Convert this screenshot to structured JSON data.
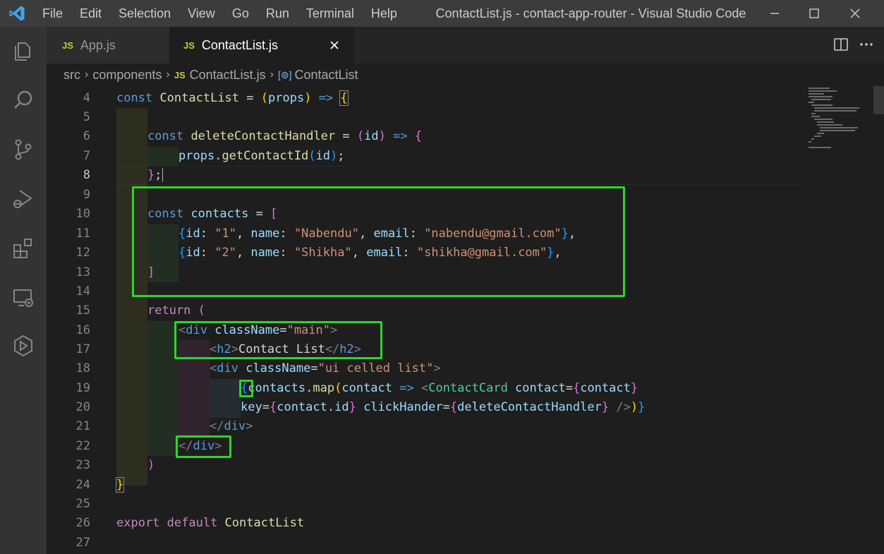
{
  "app": {
    "window_title": "ContactList.js - contact-app-router - Visual Studio Code",
    "menu": [
      "File",
      "Edit",
      "Selection",
      "View",
      "Go",
      "Run",
      "Terminal",
      "Help"
    ]
  },
  "tabs": [
    {
      "badge": "JS",
      "label": "App.js",
      "active": false
    },
    {
      "badge": "JS",
      "label": "ContactList.js",
      "active": true
    }
  ],
  "breadcrumb": {
    "items": [
      "src",
      "components",
      "ContactList.js",
      "ContactList"
    ],
    "file_badge": "JS",
    "symbol_badge": "[⊚]"
  },
  "activity_icons": [
    "explorer-icon",
    "search-icon",
    "source-control-icon",
    "run-debug-icon",
    "extensions-icon",
    "remote-explorer-icon",
    "docker-icon"
  ],
  "editor": {
    "current_line": 8,
    "line_numbers": [
      "4",
      "5",
      "6",
      "7",
      "8",
      "9",
      "10",
      "11",
      "12",
      "13",
      "14",
      "15",
      "16",
      "17",
      "18",
      "19",
      "20",
      "21",
      "22",
      "23",
      "24",
      "25",
      "26",
      "27"
    ],
    "code": {
      "l4_const": "const",
      "l4_name": "ContactList",
      "l4_eq": " = ",
      "l4_open": "(",
      "l4_param": "props",
      "l4_close": ")",
      "l4_arrow": " => ",
      "l4_brace": "{",
      "l6_const": "const",
      "l6_name": "deleteContactHandler",
      "l6_eq": " = ",
      "l6_open": "(",
      "l6_param": "id",
      "l6_close": ")",
      "l6_arrow": " => ",
      "l6_brace": "{",
      "l7_obj": "props",
      "l7_dot": ".",
      "l7_fn": "getContactId",
      "l7_open": "(",
      "l7_arg": "id",
      "l7_close": ")",
      "l7_semi": ";",
      "l8_brace": "}",
      "l8_semi": ";",
      "l10_const": "const",
      "l10_name": "contacts",
      "l10_eq": " = ",
      "l10_open": "[",
      "l11_text": "{id: \"1\", name: \"Nabendu\", email: \"nabendu@gmail.com\"},",
      "l11_ob": "{",
      "l11_k1": "id",
      "l11_c1": ": ",
      "l11_v1": "\"1\"",
      "l11_sep1": ", ",
      "l11_k2": "name",
      "l11_c2": ": ",
      "l11_v2": "\"Nabendu\"",
      "l11_sep2": ", ",
      "l11_k3": "email",
      "l11_c3": ": ",
      "l11_v3": "\"nabendu@gmail.com\"",
      "l11_cb": "}",
      "l11_end": ",",
      "l12_ob": "{",
      "l12_k1": "id",
      "l12_c1": ": ",
      "l12_v1": "\"2\"",
      "l12_sep1": ", ",
      "l12_k2": "name",
      "l12_c2": ": ",
      "l12_v2": "\"Shikha\"",
      "l12_sep2": ", ",
      "l12_k3": "email",
      "l12_c3": ": ",
      "l12_v3": "\"shikha@gmail.com\"",
      "l12_cb": "}",
      "l12_end": ",",
      "l13_close": "]",
      "l15_return": "return",
      "l15_paren": " (",
      "l16_lt": "<",
      "l16_tag": "div",
      "l16_attr": " className",
      "l16_eq": "=",
      "l16_val": "\"main\"",
      "l16_gt": ">",
      "l17_lt": "<",
      "l17_tag": "h2",
      "l17_gt": ">",
      "l17_text": "Contact List",
      "l17_lt2": "</",
      "l17_tag2": "h2",
      "l17_gt2": ">",
      "l18_lt": "<",
      "l18_tag": "div",
      "l18_attr": " className",
      "l18_eq": "=",
      "l18_val": "\"ui celled list\"",
      "l18_gt": ">",
      "l19_ob": "{",
      "l19_obj": "contacts",
      "l19_dot": ".",
      "l19_fn": "map",
      "l19_op": "(",
      "l19_param": "contact",
      "l19_arrow": " => ",
      "l19_lt": "<",
      "l19_comp": "ContactCard",
      "l19_attr": " contact",
      "l19_eq": "=",
      "l19_eb": "{",
      "l19_ev": "contact",
      "l19_ecb": "}",
      "l20_attr": "key",
      "l20_eq": "=",
      "l20_eb": "{",
      "l20_ev": "contact.id",
      "l20_ecb": "}",
      "l20_attr2": " clickHander",
      "l20_eq2": "=",
      "l20_eb2": "{",
      "l20_ev2": "deleteContactHandler",
      "l20_ecb2": "}",
      "l20_self": " />",
      "l20_cp": ")",
      "l20_cb": "}",
      "l21_lt": "</",
      "l21_tag": "div",
      "l21_gt": ">",
      "l22_lt": "</",
      "l22_tag": "div",
      "l22_gt": ">",
      "l23_paren": ")",
      "l24_brace": "}",
      "l26_export": "export",
      "l26_default": " default",
      "l26_name": " ContactList"
    }
  }
}
